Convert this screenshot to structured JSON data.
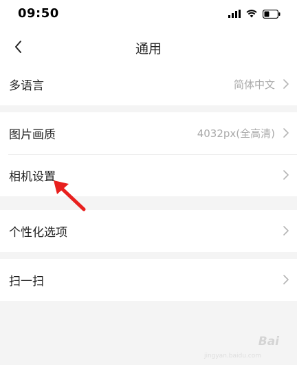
{
  "status_bar": {
    "time": "09:50"
  },
  "nav": {
    "title": "通用"
  },
  "groups": [
    {
      "items": [
        {
          "label": "多语言",
          "value": "简体中文"
        }
      ]
    },
    {
      "items": [
        {
          "label": "图片画质",
          "value": "4032px(全高清)"
        },
        {
          "label": "相机设置",
          "value": ""
        }
      ]
    },
    {
      "items": [
        {
          "label": "个性化选项",
          "value": ""
        }
      ]
    },
    {
      "items": [
        {
          "label": "扫一扫",
          "value": ""
        }
      ]
    }
  ],
  "watermark": {
    "text": "Bai",
    "sub": "jingyan.baidu.com"
  },
  "colors": {
    "annotation_arrow": "#e8201e",
    "background": "#f4f4f4"
  },
  "icons": [
    "signal-icon",
    "wifi-icon",
    "battery-icon",
    "back-icon",
    "chevron-right-icon"
  ]
}
